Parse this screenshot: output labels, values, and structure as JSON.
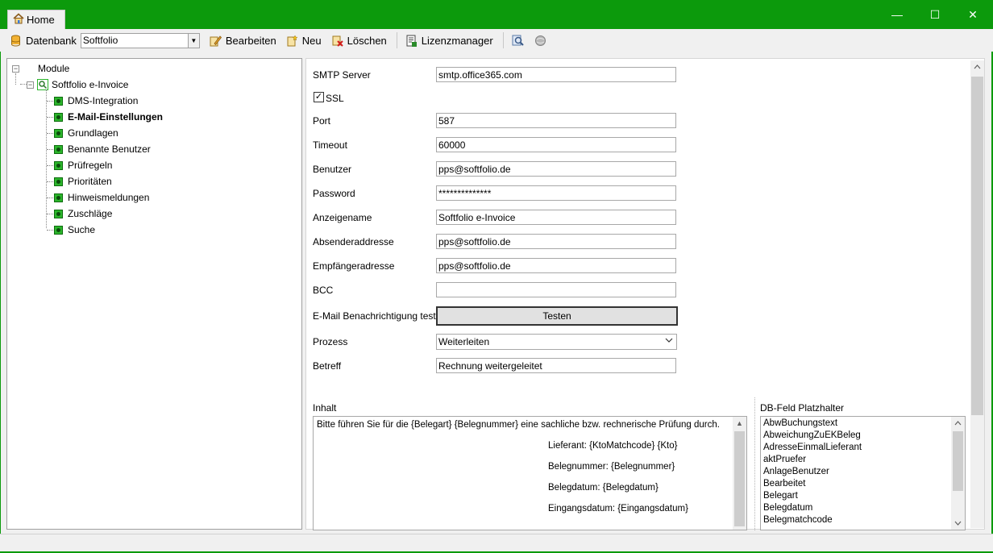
{
  "titlebar": {
    "tab_label": "Home",
    "minimize": "—",
    "maximize": "☐",
    "close": "✕",
    "color": "#0c9a0c"
  },
  "toolbar": {
    "db_label": "Datenbank",
    "db_value": "Softfolio",
    "edit_label": "Bearbeiten",
    "new_label": "Neu",
    "delete_label": "Löschen",
    "license_label": "Lizenzmanager"
  },
  "tree": {
    "root": "Module",
    "module": "Softfolio e-Invoice",
    "items": [
      {
        "label": "DMS-Integration",
        "selected": false
      },
      {
        "label": "E-Mail-Einstellungen",
        "selected": true
      },
      {
        "label": "Grundlagen",
        "selected": false
      },
      {
        "label": "Benannte Benutzer",
        "selected": false
      },
      {
        "label": "Prüfregeln",
        "selected": false
      },
      {
        "label": "Prioritäten",
        "selected": false
      },
      {
        "label": "Hinweismeldungen",
        "selected": false
      },
      {
        "label": "Zuschläge",
        "selected": false
      },
      {
        "label": "Suche",
        "selected": false
      }
    ]
  },
  "form": {
    "smtp_label": "SMTP Server",
    "smtp_value": "smtp.office365.com",
    "ssl_label": "SSL",
    "ssl_checked": true,
    "port_label": "Port",
    "port_value": "587",
    "timeout_label": "Timeout",
    "timeout_value": "60000",
    "user_label": "Benutzer",
    "user_value": "pps@softfolio.de",
    "password_label": "Password",
    "password_value": "**************",
    "display_label": "Anzeigename",
    "display_value": "Softfolio e-Invoice",
    "sender_label": "Absenderaddresse",
    "sender_value": "pps@softfolio.de",
    "recipient_label": "Empfängeradresse",
    "recipient_value": "pps@softfolio.de",
    "bcc_label": "BCC",
    "bcc_value": "",
    "test_label": "E-Mail Benachrichtigung testen",
    "test_button": "Testen",
    "process_label": "Prozess",
    "process_value": "Weiterleiten",
    "subject_label": "Betreff",
    "subject_value": "Rechnung weitergeleitet"
  },
  "content": {
    "label": "Inhalt",
    "lines": [
      "Bitte führen Sie für die {Belegart} {Belegnummer} eine sachliche bzw. rechnerische Prüfung durch.",
      "Lieferant: {KtoMatchcode} {Kto}",
      "Belegnummer: {Belegnummer}",
      "Belegdatum: {Belegdatum}",
      "Eingangsdatum: {Eingangsdatum}"
    ]
  },
  "placeholders": {
    "label": "DB-Feld Platzhalter",
    "items": [
      "AbwBuchungstext",
      "AbweichungZuEKBeleg",
      "AdresseEinmalLieferant",
      "aktPruefer",
      "AnlageBenutzer",
      "Bearbeitet",
      "Belegart",
      "Belegdatum",
      "Belegmatchcode"
    ]
  }
}
